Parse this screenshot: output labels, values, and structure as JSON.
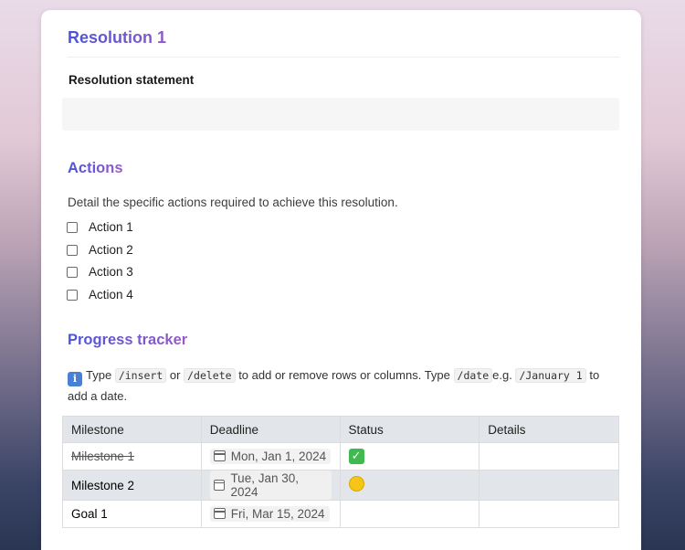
{
  "page": {
    "title": "Resolution 1",
    "statement_label": "Resolution statement",
    "statement_value": ""
  },
  "actions": {
    "heading": "Actions",
    "description": "Detail the specific actions required to achieve this resolution.",
    "items": [
      {
        "label": "Action 1",
        "checked": false
      },
      {
        "label": "Action 2",
        "checked": false
      },
      {
        "label": "Action 3",
        "checked": false
      },
      {
        "label": "Action 4",
        "checked": false
      }
    ]
  },
  "progress": {
    "heading": "Progress tracker",
    "tip": {
      "icon": "info-icon",
      "t1": "Type",
      "c1": "/insert",
      "t2": "or",
      "c2": "/delete",
      "t3": "to add or remove rows or columns. Type",
      "c3": "/date",
      "t4": "e.g.",
      "c4": "/January 1",
      "t5": "to add a date."
    },
    "table": {
      "headers": [
        "Milestone",
        "Deadline",
        "Status",
        "Details"
      ],
      "rows": [
        {
          "milestone": "Milestone 1",
          "deadline": "Mon, Jan 1, 2024",
          "status": "check-mark-emoji",
          "details": "",
          "struck": true
        },
        {
          "milestone": "Milestone 2",
          "deadline": "Tue, Jan 30, 2024",
          "status": "yellow-circle-emoji",
          "details": "",
          "struck": false
        },
        {
          "milestone": "Goal 1",
          "deadline": "Fri, Mar 15, 2024",
          "status": "",
          "details": "",
          "struck": false
        }
      ]
    }
  },
  "colors": {
    "heading_gradient_start": "#4a54d6",
    "heading_gradient_end": "#9a5bc4",
    "table_header_bg": "#e2e5e9",
    "status_green": "#3fb950",
    "status_yellow": "#f5c518"
  }
}
